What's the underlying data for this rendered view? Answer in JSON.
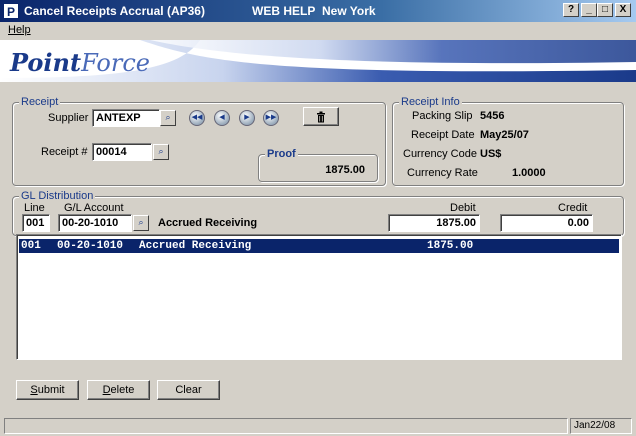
{
  "window": {
    "title": "Cancel Receipts Accrual (AP36)",
    "help_label": "WEB HELP",
    "location": "New York",
    "controls": [
      "?",
      "_",
      "□",
      "X"
    ]
  },
  "menu": {
    "help": "Help"
  },
  "banner": {
    "logo_bold": "Point",
    "logo_rest": "Force"
  },
  "receipt": {
    "group_label": "Receipt",
    "supplier_label": "Supplier",
    "supplier_value": "ANTEXP",
    "receipt_no_label": "Receipt #",
    "receipt_no_value": "00014",
    "nav_first": "◀◀",
    "nav_prev": "◀",
    "nav_next": "▶",
    "nav_last": "▶▶",
    "delete_icon": "trash-icon"
  },
  "proof": {
    "label": "Proof",
    "value": "1875.00"
  },
  "receipt_info": {
    "group_label": "Receipt Info",
    "packing_slip_label": "Packing Slip",
    "packing_slip_value": "5456",
    "receipt_date_label": "Receipt Date",
    "receipt_date_value": "May25/07",
    "currency_code_label": "Currency Code",
    "currency_code_value": "US$",
    "currency_rate_label": "Currency Rate",
    "currency_rate_value": "1.0000"
  },
  "gl": {
    "group_label": "GL Distribution",
    "line_header": "Line",
    "account_header": "G/L Account",
    "debit_header": "Debit",
    "credit_header": "Credit",
    "line_value": "001",
    "account_value": "00-20-1010",
    "account_desc": "Accrued Receiving",
    "debit_value": "1875.00",
    "credit_value": "0.00"
  },
  "rows": [
    {
      "line": "001",
      "account": "00-20-1010",
      "desc": "Accrued Receiving",
      "amount": "1875.00"
    }
  ],
  "buttons": {
    "submit_u": "S",
    "submit_rest": "ubmit",
    "delete_u": "D",
    "delete_rest": "elete",
    "clear": "Clear"
  },
  "status": {
    "date": "Jan22/08"
  }
}
